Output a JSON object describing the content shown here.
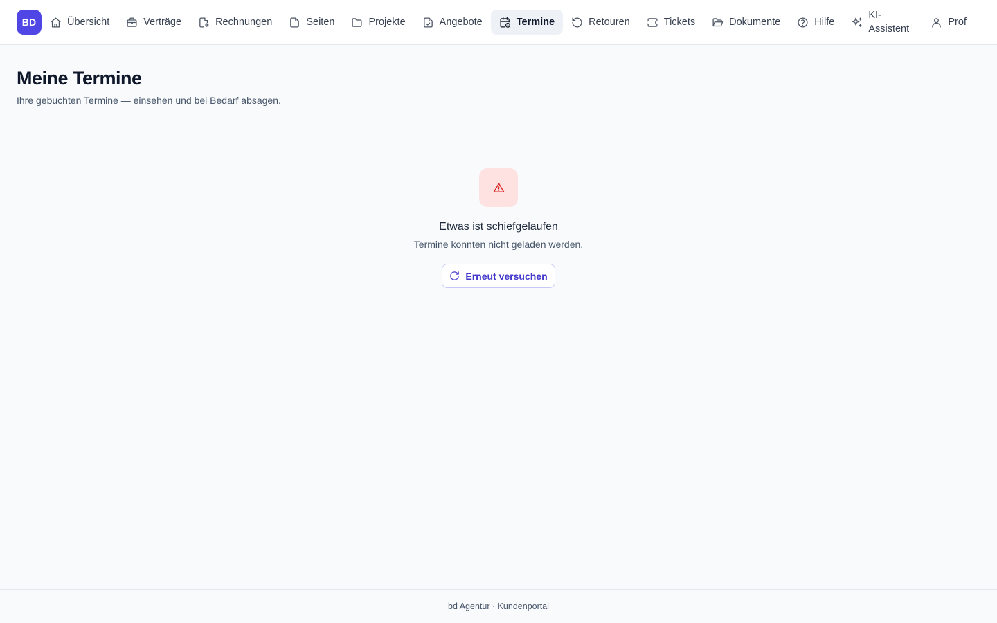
{
  "nav": {
    "logo": "BD",
    "items": [
      {
        "label": "Übersicht",
        "icon": "home-icon"
      },
      {
        "label": "Verträge",
        "icon": "briefcase-icon"
      },
      {
        "label": "Rechnungen",
        "icon": "invoice-icon"
      },
      {
        "label": "Seiten",
        "icon": "file-icon"
      },
      {
        "label": "Projekte",
        "icon": "folder-icon"
      },
      {
        "label": "Angebote",
        "icon": "file-check-icon"
      },
      {
        "label": "Termine",
        "icon": "calendar-clock-icon",
        "active": true
      },
      {
        "label": "Retouren",
        "icon": "rotate-ccw-icon"
      },
      {
        "label": "Tickets",
        "icon": "ticket-icon"
      },
      {
        "label": "Dokumente",
        "icon": "folder-open-icon"
      },
      {
        "label": "Hilfe",
        "icon": "help-circle-icon"
      },
      {
        "label": "KI-Assistent",
        "label_line1": "KI-",
        "label_line2": "Assistent",
        "icon": "sparkles-icon"
      },
      {
        "label": "Prof",
        "icon": "user-icon"
      }
    ]
  },
  "page": {
    "title": "Meine Termine",
    "subtitle": "Ihre gebuchten Termine — einsehen und bei Bedarf absagen."
  },
  "error": {
    "icon": "alert-triangle-icon",
    "title": "Etwas ist schiefgelaufen",
    "message": "Termine konnten nicht geladen werden.",
    "retry_label": "Erneut versuchen",
    "retry_icon": "refresh-icon"
  },
  "footer": {
    "text": "bd Agentur · Kundenportal"
  },
  "colors": {
    "brand": "#4f46e5",
    "error_bg": "#fee2e2",
    "error_icon": "#dc2626",
    "page_bg": "#f8fafc"
  }
}
